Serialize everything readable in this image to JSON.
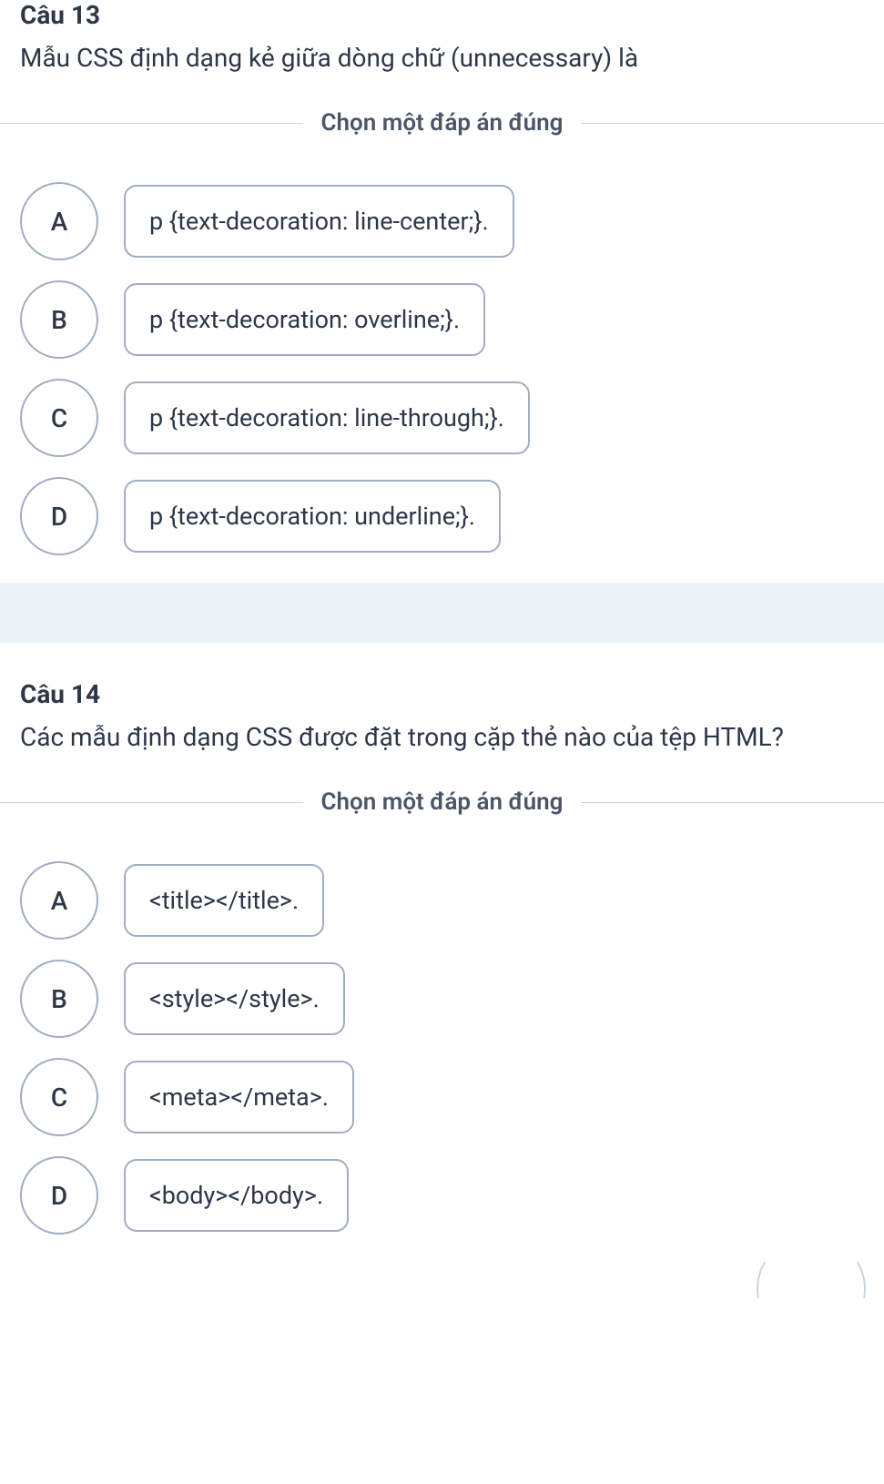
{
  "questions": [
    {
      "title": "Câu 13",
      "text": "Mẫu CSS định dạng kẻ giữa dòng chữ (unnecessary) là",
      "instruction": "Chọn một đáp án đúng",
      "options": [
        {
          "letter": "A",
          "text": "p {text-decoration: line-center;}."
        },
        {
          "letter": "B",
          "text": "p {text-decoration: overline;}."
        },
        {
          "letter": "C",
          "text": "p {text-decoration: line-through;}."
        },
        {
          "letter": "D",
          "text": "p {text-decoration: underline;}."
        }
      ]
    },
    {
      "title": "Câu 14",
      "text": "Các mẫu định dạng CSS được đặt trong cặp thẻ nào của tệp HTML?",
      "instruction": "Chọn một đáp án đúng",
      "options": [
        {
          "letter": "A",
          "text": "<title></title>."
        },
        {
          "letter": "B",
          "text": "<style></style>."
        },
        {
          "letter": "C",
          "text": "<meta></meta>."
        },
        {
          "letter": "D",
          "text": "<body></body>."
        }
      ]
    }
  ]
}
